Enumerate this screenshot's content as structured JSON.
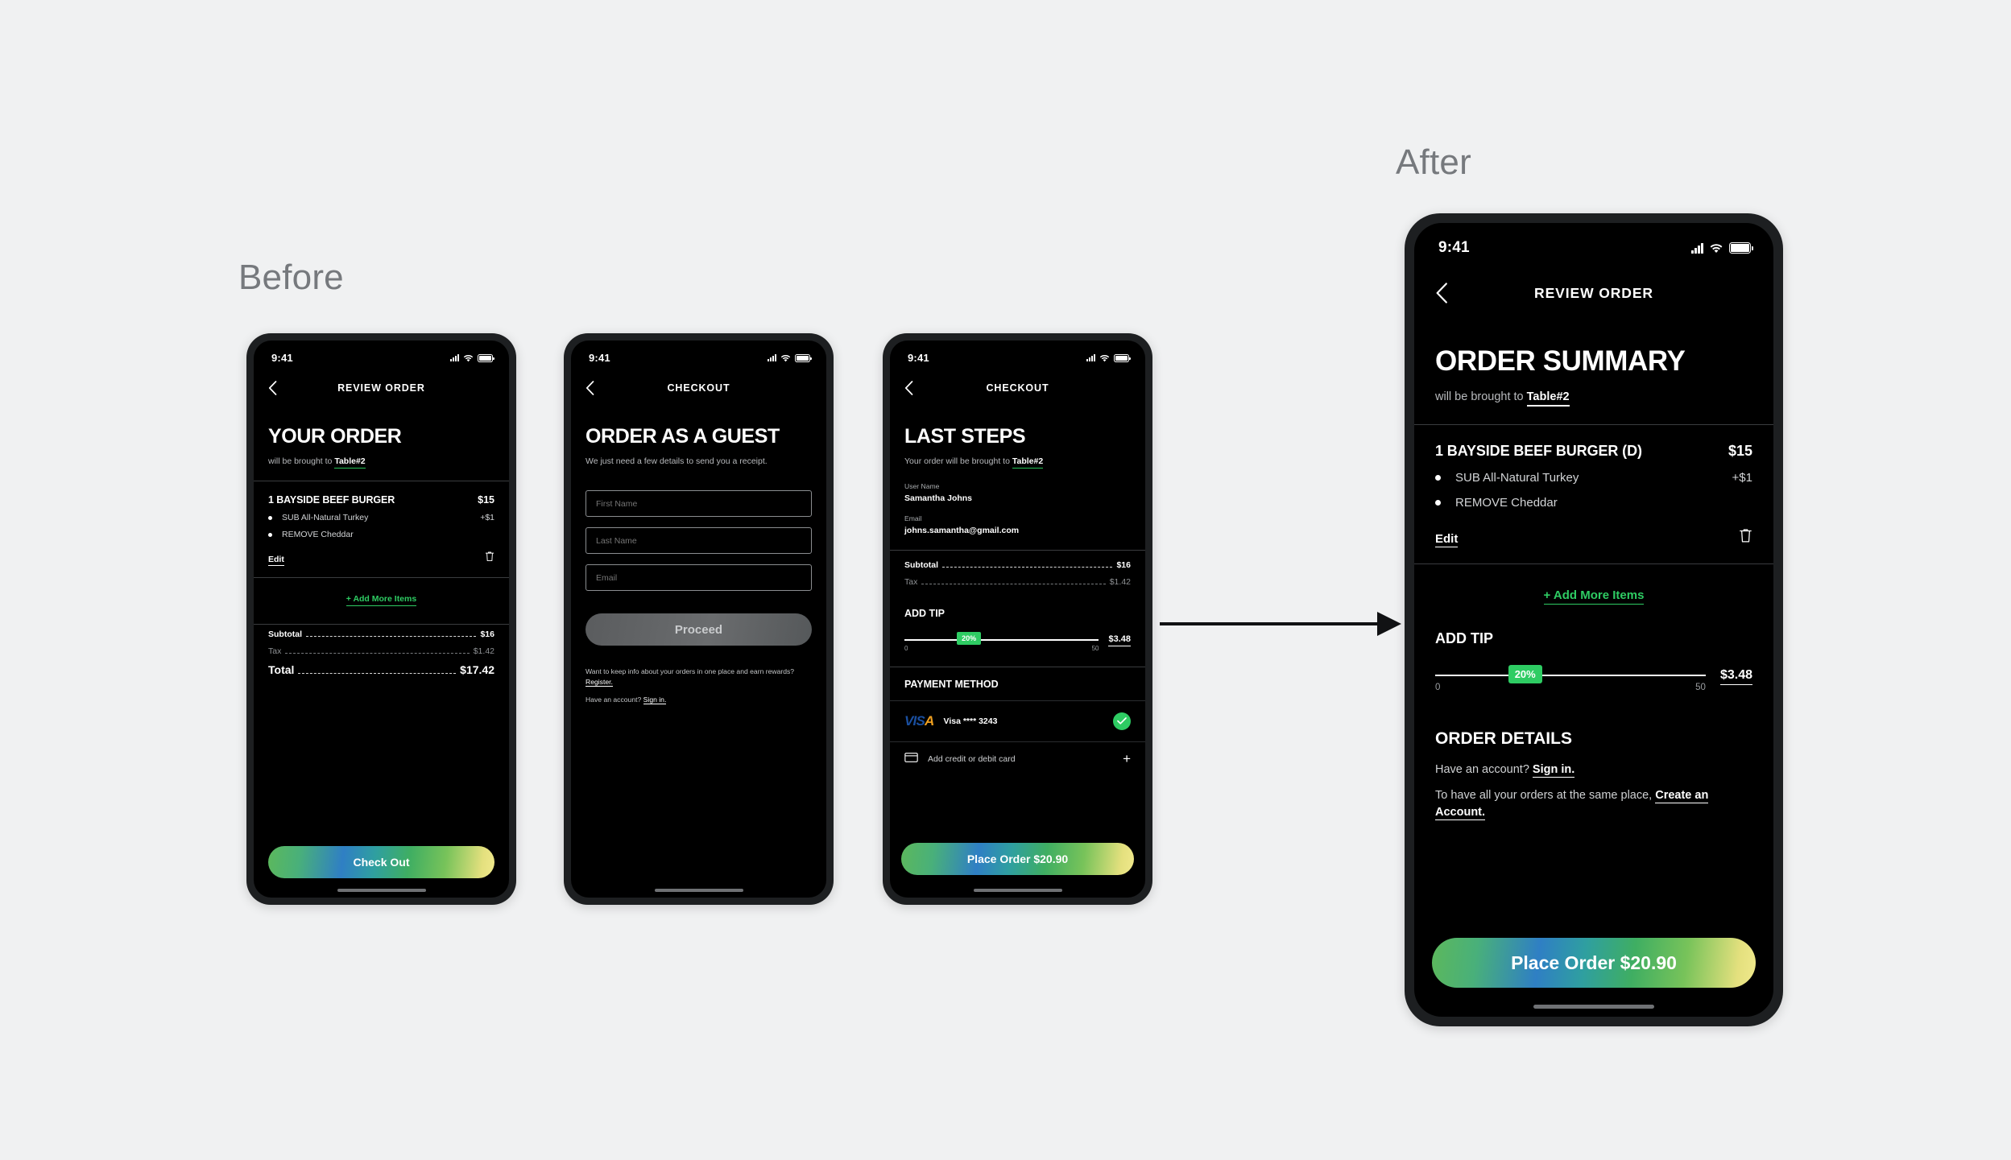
{
  "labels": {
    "before": "Before",
    "after": "After"
  },
  "status_bar": {
    "time": "9:41",
    "signal_icon": "cellular-signal-icon",
    "wifi_icon": "wifi-icon",
    "battery_icon": "battery-icon"
  },
  "screens": {
    "review_order": {
      "nav_title": "REVIEW ORDER",
      "back_icon": "chevron-left-icon",
      "heading": "YOUR ORDER",
      "subline_prefix": "will be brought to ",
      "table": "Table#2",
      "item": {
        "name": "1 BAYSIDE BEEF BURGER",
        "price": "$15",
        "modifiers": [
          {
            "label": "SUB All-Natural Turkey",
            "price": "+$1"
          },
          {
            "label": "REMOVE Cheddar",
            "price": ""
          }
        ],
        "edit_label": "Edit",
        "delete_icon": "trash-icon"
      },
      "add_more_label": "+ Add More Items",
      "totals": [
        {
          "label": "Subtotal",
          "value": "$16"
        },
        {
          "label": "Tax",
          "value": "$1.42"
        },
        {
          "label": "Total",
          "value": "$17.42"
        }
      ],
      "cta_label": "Check Out"
    },
    "guest_checkout": {
      "nav_title": "CHECKOUT",
      "back_icon": "chevron-left-icon",
      "heading": "ORDER AS A GUEST",
      "subline": "We just need a few details to send you a receipt.",
      "fields": [
        {
          "name": "first-name-field",
          "placeholder": "First Name",
          "value": ""
        },
        {
          "name": "last-name-field",
          "placeholder": "Last Name",
          "value": ""
        },
        {
          "name": "email-field",
          "placeholder": "Email",
          "value": ""
        }
      ],
      "cta_label": "Proceed",
      "footer_register": "Want to keep info about your orders in one place and earn rewards? ",
      "footer_register_link": "Register.",
      "footer_signin": "Have an account? ",
      "footer_signin_link": "Sign in."
    },
    "last_steps": {
      "nav_title": "CHECKOUT",
      "back_icon": "chevron-left-icon",
      "heading": "LAST STEPS",
      "subline_prefix": "Your order will be brought to ",
      "table": "Table#2",
      "user_name_label": "User Name",
      "user_name_value": "Samantha Johns",
      "email_label": "Email",
      "email_value": "johns.samantha@gmail.com",
      "totals": [
        {
          "label": "Subtotal",
          "value": "$16"
        },
        {
          "label": "Tax",
          "value": "$1.42"
        }
      ],
      "tip_title": "ADD TIP",
      "tip_percent": "20%",
      "tip_min": "0",
      "tip_max": "50",
      "tip_amount": "$3.48",
      "payment_title": "PAYMENT METHOD",
      "card_brand": "VISA",
      "card_label": "Visa **** 3243",
      "card_selected_icon": "check-circle-icon",
      "add_card_icon": "credit-card-icon",
      "add_card_label": "Add credit or debit card",
      "add_card_plus_icon": "plus-icon",
      "cta_label": "Place Order $20.90"
    },
    "order_summary": {
      "nav_title": "REVIEW ORDER",
      "back_icon": "chevron-left-icon",
      "heading": "ORDER SUMMARY",
      "subline_prefix": "will be brought to ",
      "table": "Table#2",
      "item": {
        "name": "1 BAYSIDE BEEF BURGER (D)",
        "price": "$15",
        "modifiers": [
          {
            "label": "SUB All-Natural Turkey",
            "price": "+$1"
          },
          {
            "label": "REMOVE Cheddar",
            "price": ""
          }
        ],
        "edit_label": "Edit",
        "delete_icon": "trash-icon"
      },
      "add_more_label": "+ Add More Items",
      "tip_title": "ADD TIP",
      "tip_percent": "20%",
      "tip_min": "0",
      "tip_max": "50",
      "tip_amount": "$3.48",
      "details_title": "ORDER DETAILS",
      "signin_prefix": "Have an account? ",
      "signin_link": "Sign in.",
      "create_prefix": "To have all your orders at the same place, ",
      "create_link": "Create an Account.",
      "cta_label": "Place Order $20.90"
    }
  },
  "colors": {
    "page_bg": "#f0f1f2",
    "label_gray": "#76797d",
    "screen_bg": "#000000",
    "frame": "#1d1f21",
    "accent_green": "#2ecc63",
    "tip_green": "#2ecc63",
    "visa_blue": "#1a4fa0",
    "visa_gold": "#f0a020"
  }
}
